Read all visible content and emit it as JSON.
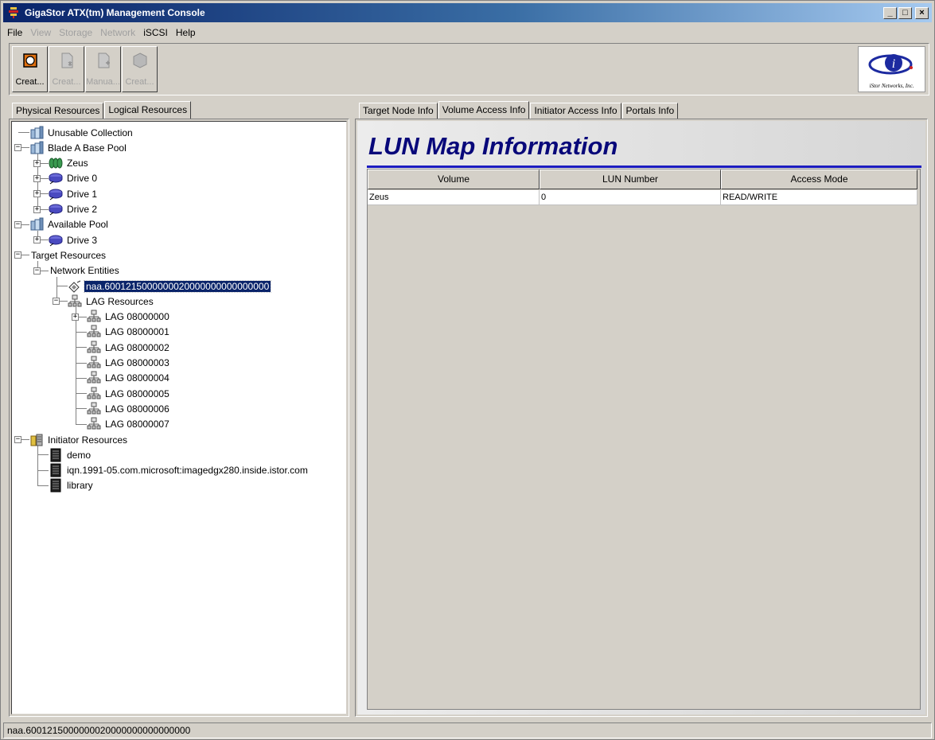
{
  "window": {
    "title": "GigaStor ATX(tm) Management Console",
    "min_glyph": "_",
    "max_glyph": "□",
    "close_glyph": "×"
  },
  "menu": [
    {
      "label": "File",
      "enabled": true
    },
    {
      "label": "View",
      "enabled": false
    },
    {
      "label": "Storage",
      "enabled": false
    },
    {
      "label": "Network",
      "enabled": false
    },
    {
      "label": "iSCSI",
      "enabled": true
    },
    {
      "label": "Help",
      "enabled": true
    }
  ],
  "toolbar": {
    "buttons": [
      {
        "label": "Creat...",
        "icon": "create-target-icon",
        "enabled": true
      },
      {
        "label": "Creat...",
        "icon": "create-lun-icon",
        "enabled": false
      },
      {
        "label": "Manua...",
        "icon": "manual-config-icon",
        "enabled": false
      },
      {
        "label": "Creat...",
        "icon": "create-volume-icon",
        "enabled": false
      }
    ],
    "logo_text": "iStor Networks, Inc."
  },
  "left_tabs": [
    "Physical Resources",
    "Logical Resources"
  ],
  "left_active_tab": 1,
  "tree": [
    {
      "label": "Unusable Collection",
      "icon": "pool-icon",
      "depth": 0,
      "expander": ""
    },
    {
      "label": "Blade A Base Pool",
      "icon": "pool-icon",
      "depth": 0,
      "expander": "-"
    },
    {
      "label": "Zeus",
      "icon": "volume-icon",
      "depth": 1,
      "expander": "+"
    },
    {
      "label": "Drive 0",
      "icon": "drive-icon",
      "depth": 1,
      "expander": "+"
    },
    {
      "label": "Drive 1",
      "icon": "drive-icon",
      "depth": 1,
      "expander": "+"
    },
    {
      "label": "Drive 2",
      "icon": "drive-icon",
      "depth": 1,
      "expander": "+"
    },
    {
      "label": "Available Pool",
      "icon": "pool-icon",
      "depth": 0,
      "expander": "-"
    },
    {
      "label": "Drive 3",
      "icon": "drive-icon",
      "depth": 1,
      "expander": "+"
    },
    {
      "label": "Target Resources",
      "icon": "",
      "depth": 0,
      "expander": "-"
    },
    {
      "label": "Network Entities",
      "icon": "",
      "depth": 1,
      "expander": "-"
    },
    {
      "label": "naa.6001215000000020000000000000000",
      "icon": "target-node-icon",
      "depth": 2,
      "expander": "",
      "selected": true
    },
    {
      "label": "LAG Resources",
      "icon": "lag-icon",
      "depth": 2,
      "expander": "-"
    },
    {
      "label": "LAG 08000000",
      "icon": "lag-icon",
      "depth": 3,
      "expander": "+"
    },
    {
      "label": "LAG 08000001",
      "icon": "lag-icon",
      "depth": 3,
      "expander": ""
    },
    {
      "label": "LAG 08000002",
      "icon": "lag-icon",
      "depth": 3,
      "expander": ""
    },
    {
      "label": "LAG 08000003",
      "icon": "lag-icon",
      "depth": 3,
      "expander": ""
    },
    {
      "label": "LAG 08000004",
      "icon": "lag-icon",
      "depth": 3,
      "expander": ""
    },
    {
      "label": "LAG 08000005",
      "icon": "lag-icon",
      "depth": 3,
      "expander": ""
    },
    {
      "label": "LAG 08000006",
      "icon": "lag-icon",
      "depth": 3,
      "expander": ""
    },
    {
      "label": "LAG 08000007",
      "icon": "lag-icon",
      "depth": 3,
      "expander": ""
    },
    {
      "label": "Initiator Resources",
      "icon": "initiator-group-icon",
      "depth": 0,
      "expander": "-"
    },
    {
      "label": "demo",
      "icon": "initiator-icon",
      "depth": 1,
      "expander": ""
    },
    {
      "label": "iqn.1991-05.com.microsoft:imagedgx280.inside.istor.com",
      "icon": "initiator-icon",
      "depth": 1,
      "expander": ""
    },
    {
      "label": "library",
      "icon": "initiator-icon",
      "depth": 1,
      "expander": ""
    }
  ],
  "right_tabs": [
    "Target Node Info",
    "Volume Access Info",
    "Initiator Access Info",
    "Portals Info"
  ],
  "right_active_tab": 1,
  "lun_map": {
    "title": "LUN Map Information",
    "columns": [
      "Volume",
      "LUN Number",
      "Access Mode"
    ],
    "rows": [
      [
        "Zeus",
        "0",
        "READ/WRITE"
      ]
    ]
  },
  "status_text": "naa.6001215000000020000000000000000",
  "colors": {
    "title_blue": "#08087a",
    "selection": "#0a246a",
    "chrome": "#d4d0c8"
  }
}
